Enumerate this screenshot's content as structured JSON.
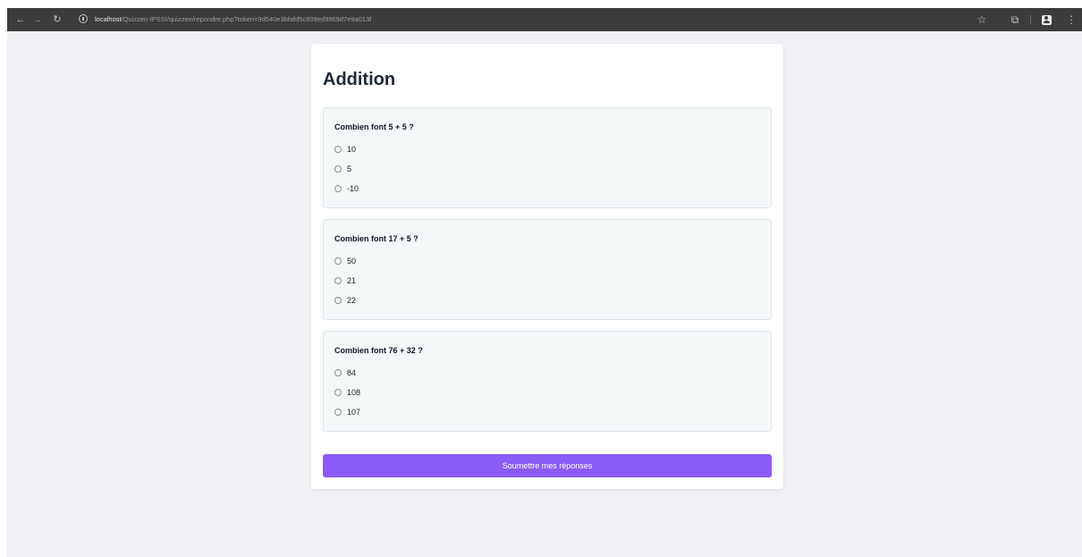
{
  "browser": {
    "url_host": "localhost",
    "url_path": "/Quizzeo-IPSSI/quizzeo/repondre.php?token=9d540e3bfafd5c609ed9969d7e9a013f",
    "icons": {
      "back": "arrow-left-icon",
      "forward": "arrow-right-icon",
      "reload": "reload-icon",
      "info": "info-icon",
      "bookmark": "star-icon",
      "extensions": "puzzle-icon",
      "profile": "profile-icon",
      "menu": "kebab-menu-icon"
    }
  },
  "quiz": {
    "title": "Addition",
    "questions": [
      {
        "text": "Combien font 5 + 5 ?",
        "options": [
          "10",
          "5",
          "-10"
        ]
      },
      {
        "text": "Combien font 17 + 5 ?",
        "options": [
          "50",
          "21",
          "22"
        ]
      },
      {
        "text": "Combien font 76 + 32 ?",
        "options": [
          "84",
          "108",
          "107"
        ]
      }
    ],
    "submit_label": "Soumettre mes réponses"
  },
  "colors": {
    "accent": "#8b5cf6",
    "page_background": "#f0eff4",
    "question_background": "#f4f8f9",
    "browser_bar": "#3c3c3c"
  }
}
